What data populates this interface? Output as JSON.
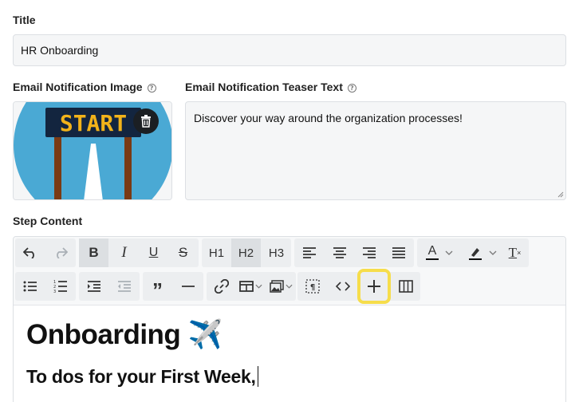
{
  "title_field": {
    "label": "Title",
    "value": "HR Onboarding"
  },
  "notification_image": {
    "label": "Email Notification Image",
    "image_text": "START",
    "help_icon": "question-circle-icon",
    "delete_icon": "trash-icon"
  },
  "teaser_field": {
    "label": "Email Notification Teaser Text",
    "value": "Discover your way around the organization processes!",
    "help_icon": "question-circle-icon"
  },
  "step_content": {
    "label": "Step Content",
    "toolbar": {
      "row1": [
        {
          "icon": "undo-icon"
        },
        {
          "icon": "redo-icon"
        },
        {
          "icon": "bold-icon",
          "text": "B"
        },
        {
          "icon": "italic-icon",
          "text": "I"
        },
        {
          "icon": "underline-icon",
          "text": "U"
        },
        {
          "icon": "strikethrough-icon",
          "text": "S"
        },
        {
          "icon": "heading-1",
          "text": "H1"
        },
        {
          "icon": "heading-2",
          "text": "H2"
        },
        {
          "icon": "heading-3",
          "text": "H3"
        },
        {
          "icon": "align-left-icon"
        },
        {
          "icon": "align-center-icon"
        },
        {
          "icon": "align-right-icon"
        },
        {
          "icon": "align-justify-icon"
        },
        {
          "icon": "font-color-icon",
          "text": "A"
        },
        {
          "icon": "highlight-icon"
        },
        {
          "icon": "clear-format-icon",
          "text": "T"
        }
      ],
      "row2": [
        {
          "icon": "bullet-list-icon"
        },
        {
          "icon": "numbered-list-icon"
        },
        {
          "icon": "indent-icon"
        },
        {
          "icon": "outdent-icon"
        },
        {
          "icon": "quote-icon"
        },
        {
          "icon": "horizontal-rule-icon"
        },
        {
          "icon": "link-icon"
        },
        {
          "icon": "table-icon"
        },
        {
          "icon": "image-icon"
        },
        {
          "icon": "paragraph-block-icon"
        },
        {
          "icon": "code-icon"
        },
        {
          "icon": "plus-icon"
        },
        {
          "icon": "columns-icon"
        }
      ]
    },
    "heading": "Onboarding ✈️",
    "subheading_plain": "To dos for your ",
    "subheading_bold": "First Week,"
  },
  "colors": {
    "highlight_ring": "#f6dd4b",
    "image_bg": "#4aa9d4",
    "sign_bg": "#13253f",
    "sign_text": "#f2b31a"
  }
}
